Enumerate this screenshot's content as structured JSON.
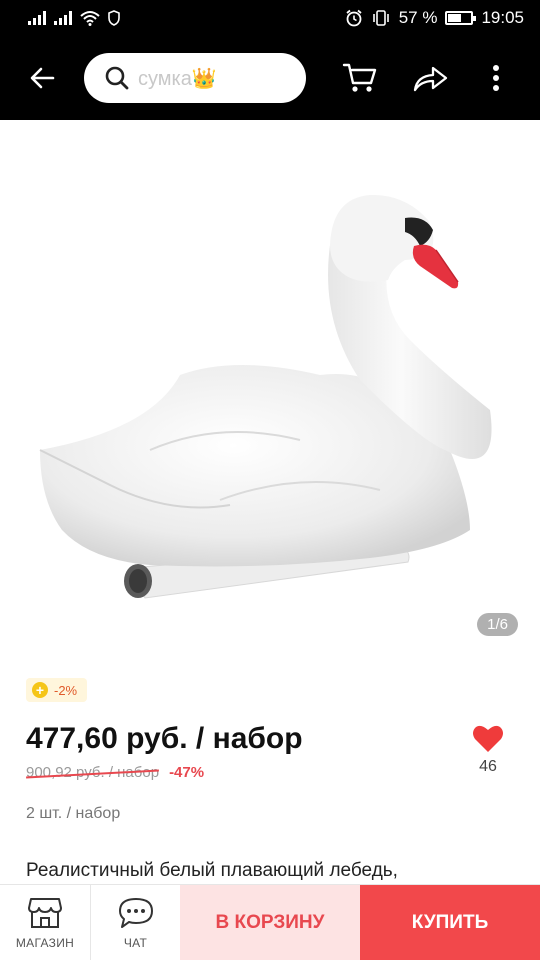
{
  "status_bar": {
    "battery_percent": "57 %",
    "battery_level": 0.57,
    "time": "19:05"
  },
  "top_bar": {
    "search_text": "сумка👑"
  },
  "gallery": {
    "counter": "1/6"
  },
  "product": {
    "coupon": "-2%",
    "price": "477,60 руб. / набор",
    "old_price": "900,92 руб. / набор",
    "discount": "-47%",
    "wishlist_count": "46",
    "unit_info": "2 шт. / набор",
    "description": "Реалистичный белый плавающий лебедь,"
  },
  "bottom_bar": {
    "store_label": "МАГАЗИН",
    "chat_label": "ЧАТ",
    "add_to_cart_label": "В КОРЗИНУ",
    "buy_label": "КУПИТЬ"
  },
  "colors": {
    "accent": "#f2484b",
    "accent_light": "#fde3e3",
    "top_bar": "#000000",
    "heart": "#ef3b3b"
  }
}
